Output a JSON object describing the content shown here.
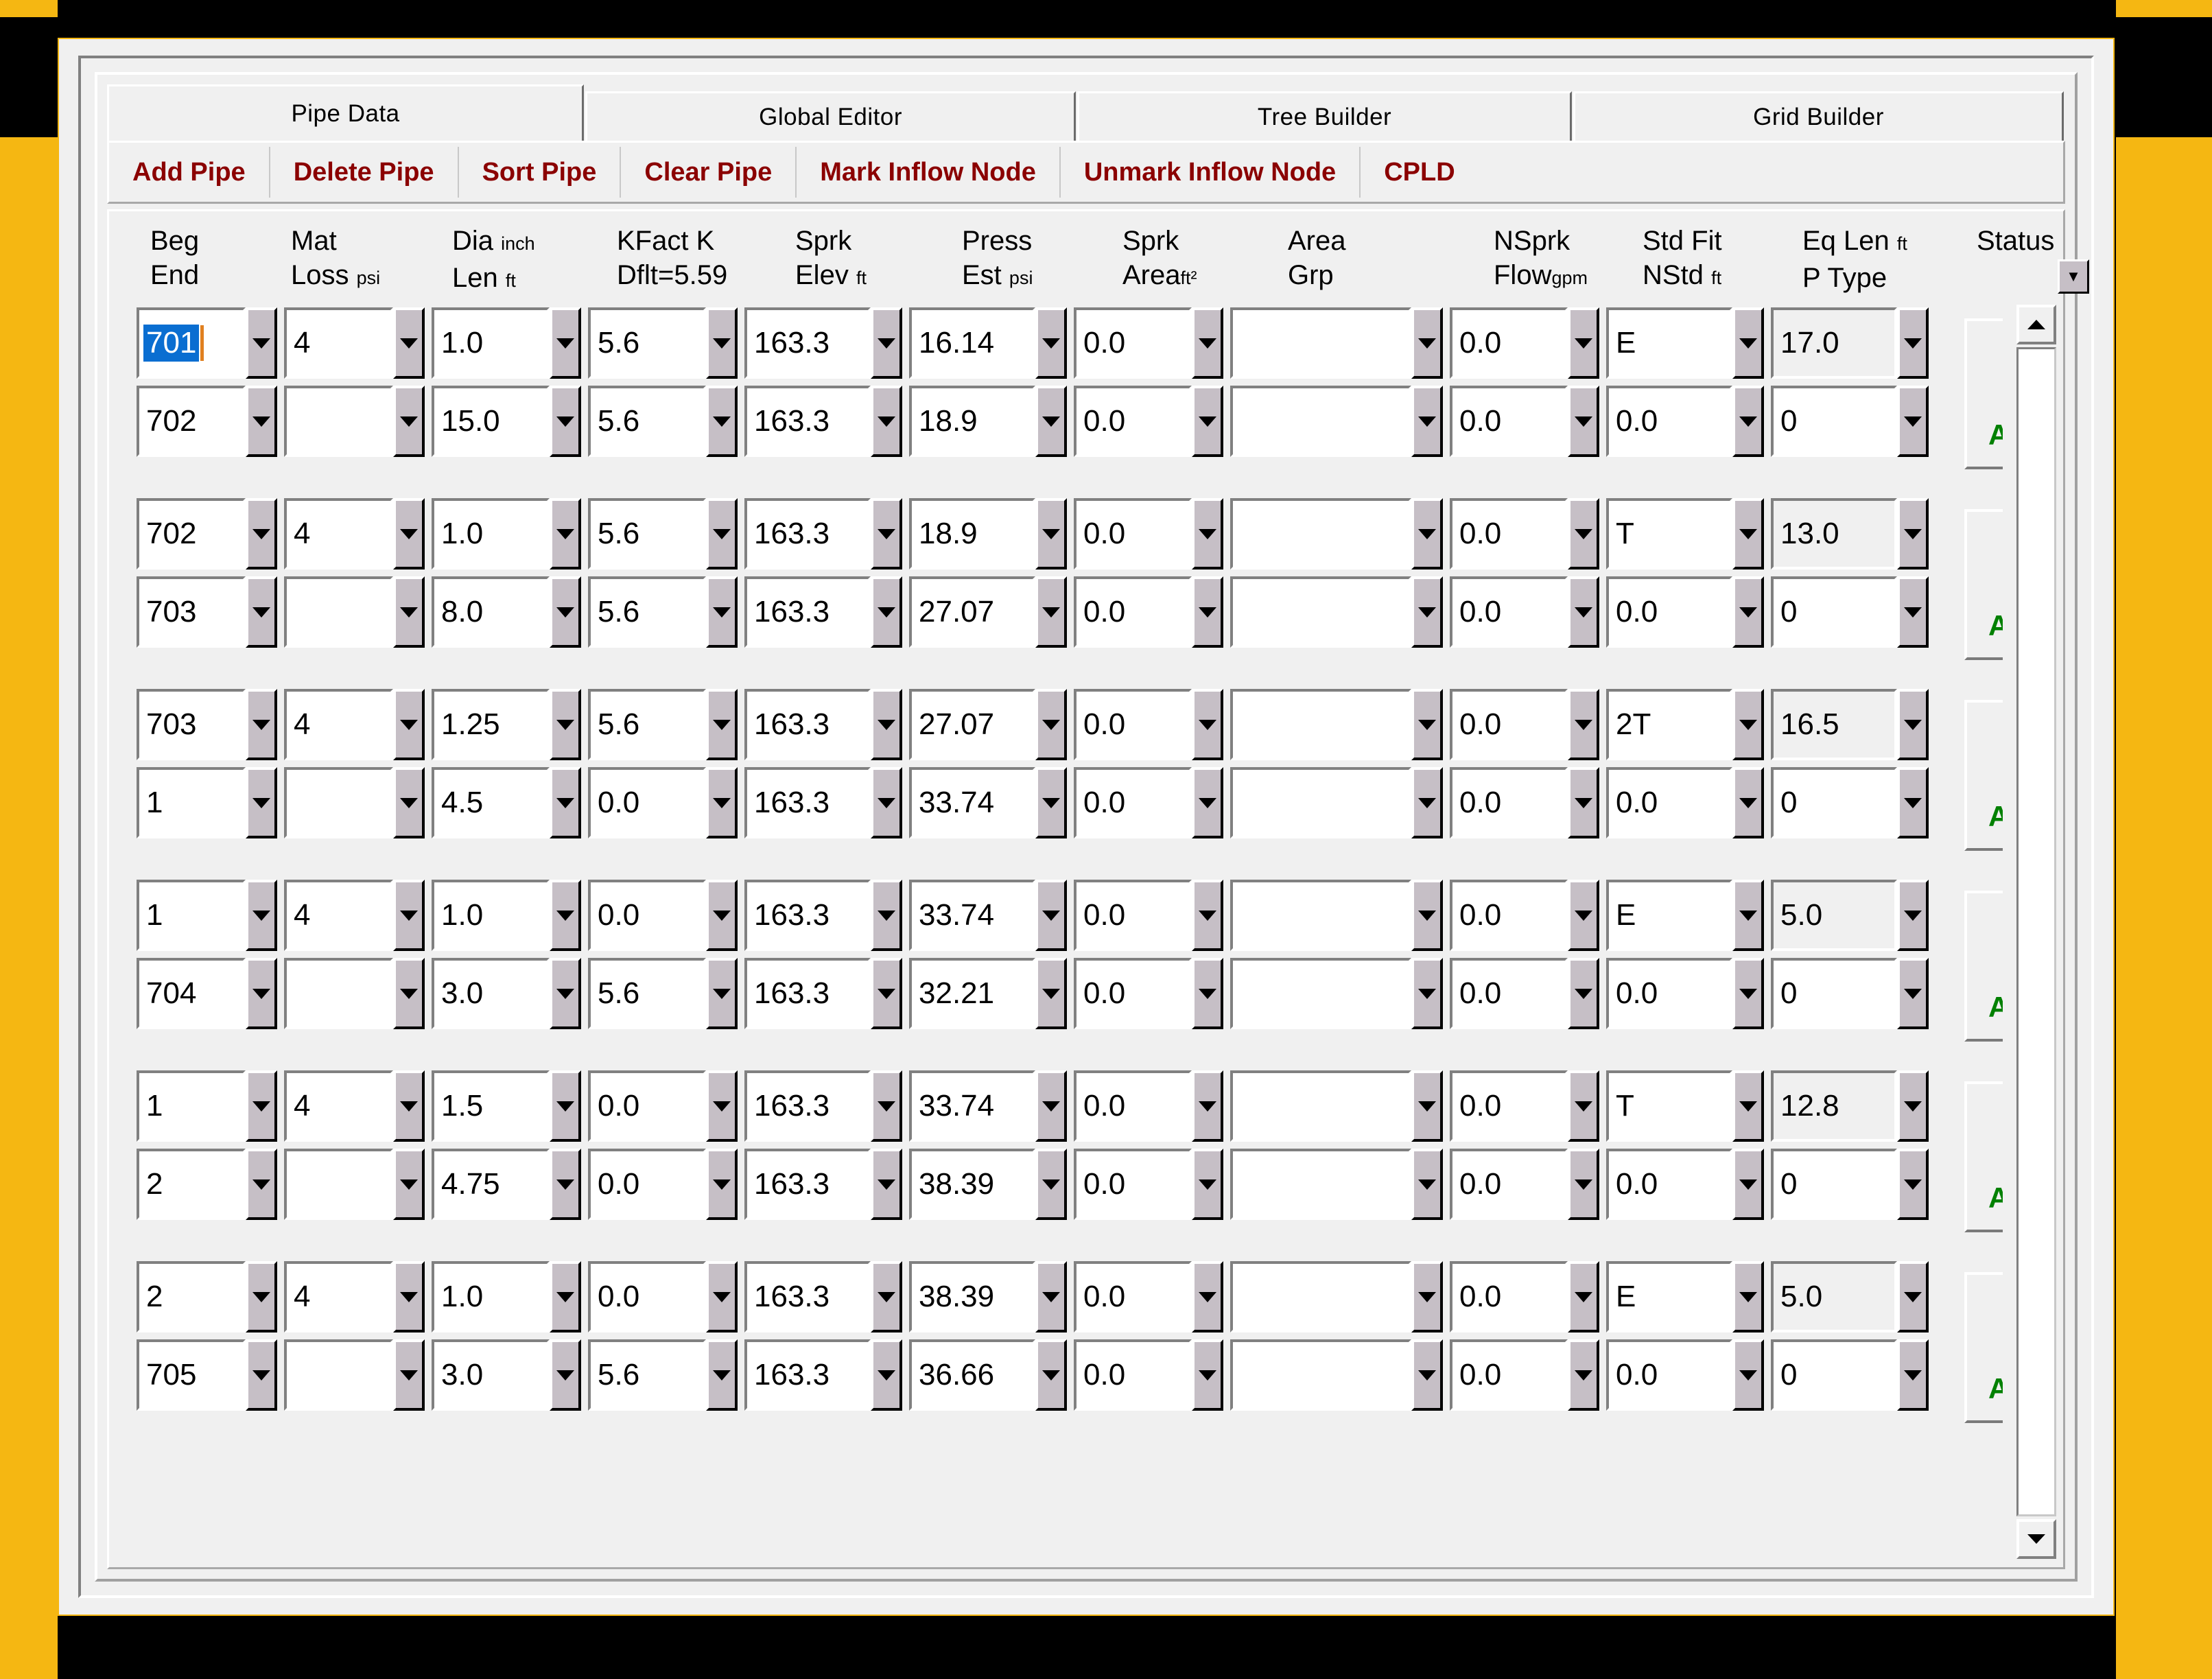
{
  "window": {
    "accent_frame_color": "#f5b712",
    "face_color": "#f0f0f0",
    "toolbar_text_color": "#8b0000",
    "status_text_color": "#008000",
    "selection_color": "#0a6ed1"
  },
  "tabs": [
    {
      "label": "Pipe Data",
      "active": true
    },
    {
      "label": "Global Editor",
      "active": false
    },
    {
      "label": "Tree Builder",
      "active": false
    },
    {
      "label": "Grid Builder",
      "active": false
    }
  ],
  "toolbar": {
    "buttons": [
      "Add Pipe",
      "Delete Pipe",
      "Sort Pipe",
      "Clear Pipe",
      "Mark Inflow Node",
      "Unmark Inflow Node",
      "CPLD"
    ]
  },
  "headers": [
    {
      "line1": "Beg",
      "line2": "End",
      "unit1": "",
      "unit2": ""
    },
    {
      "line1": "Mat",
      "line2": "Loss",
      "unit1": "",
      "unit2": "psi"
    },
    {
      "line1": "Dia",
      "line2": "Len",
      "unit1": "inch",
      "unit2": "ft"
    },
    {
      "line1": "KFact",
      "line2": "Dflt=5.59",
      "unit1": "K",
      "unit2": ""
    },
    {
      "line1": "Sprk",
      "line2": "Elev",
      "unit1": "",
      "unit2": "ft"
    },
    {
      "line1": "Press",
      "line2": "Est",
      "unit1": "",
      "unit2": "psi"
    },
    {
      "line1": "Sprk",
      "line2": "Area",
      "unit1": "",
      "unit2": "ft²"
    },
    {
      "line1": "Area",
      "line2": "Grp",
      "unit1": "",
      "unit2": ""
    },
    {
      "line1": "NSprk",
      "line2": "Flow",
      "unit1": "",
      "unit2": "gpm"
    },
    {
      "line1": "Std Fit",
      "line2": "NStd",
      "unit1": "",
      "unit2": "ft"
    },
    {
      "line1": "Eq Len",
      "line2": "P Type",
      "unit1": "ft",
      "unit2": ""
    },
    {
      "line1": "Status",
      "line2": "",
      "unit1": "",
      "unit2": ""
    }
  ],
  "pipes": [
    {
      "status": "Active",
      "beg": {
        "node": "701",
        "matloss": "4",
        "dia": "1.0",
        "kfact": "5.6",
        "elev": "163.3",
        "press": "16.14",
        "sprkarea": "0.0",
        "areagrp": "",
        "nsprk": "0.0",
        "stdfit": "E",
        "eqlen": "17.0",
        "selected": true
      },
      "end": {
        "node": "702",
        "matloss": "",
        "dia": "15.0",
        "kfact": "5.6",
        "elev": "163.3",
        "press": "18.9",
        "sprkarea": "0.0",
        "areagrp": "",
        "nsprk": "0.0",
        "stdfit": "0.0",
        "eqlen": "0",
        "selected": false
      }
    },
    {
      "status": "Active",
      "beg": {
        "node": "702",
        "matloss": "4",
        "dia": "1.0",
        "kfact": "5.6",
        "elev": "163.3",
        "press": "18.9",
        "sprkarea": "0.0",
        "areagrp": "",
        "nsprk": "0.0",
        "stdfit": "T",
        "eqlen": "13.0",
        "selected": false
      },
      "end": {
        "node": "703",
        "matloss": "",
        "dia": "8.0",
        "kfact": "5.6",
        "elev": "163.3",
        "press": "27.07",
        "sprkarea": "0.0",
        "areagrp": "",
        "nsprk": "0.0",
        "stdfit": "0.0",
        "eqlen": "0",
        "selected": false
      }
    },
    {
      "status": "Active",
      "beg": {
        "node": "703",
        "matloss": "4",
        "dia": "1.25",
        "kfact": "5.6",
        "elev": "163.3",
        "press": "27.07",
        "sprkarea": "0.0",
        "areagrp": "",
        "nsprk": "0.0",
        "stdfit": "2T",
        "eqlen": "16.5",
        "selected": false
      },
      "end": {
        "node": "1",
        "matloss": "",
        "dia": "4.5",
        "kfact": "0.0",
        "elev": "163.3",
        "press": "33.74",
        "sprkarea": "0.0",
        "areagrp": "",
        "nsprk": "0.0",
        "stdfit": "0.0",
        "eqlen": "0",
        "selected": false
      }
    },
    {
      "status": "Active",
      "beg": {
        "node": "1",
        "matloss": "4",
        "dia": "1.0",
        "kfact": "0.0",
        "elev": "163.3",
        "press": "33.74",
        "sprkarea": "0.0",
        "areagrp": "",
        "nsprk": "0.0",
        "stdfit": "E",
        "eqlen": "5.0",
        "selected": false
      },
      "end": {
        "node": "704",
        "matloss": "",
        "dia": "3.0",
        "kfact": "5.6",
        "elev": "163.3",
        "press": "32.21",
        "sprkarea": "0.0",
        "areagrp": "",
        "nsprk": "0.0",
        "stdfit": "0.0",
        "eqlen": "0",
        "selected": false
      }
    },
    {
      "status": "Active",
      "beg": {
        "node": "1",
        "matloss": "4",
        "dia": "1.5",
        "kfact": "0.0",
        "elev": "163.3",
        "press": "33.74",
        "sprkarea": "0.0",
        "areagrp": "",
        "nsprk": "0.0",
        "stdfit": "T",
        "eqlen": "12.8",
        "selected": false
      },
      "end": {
        "node": "2",
        "matloss": "",
        "dia": "4.75",
        "kfact": "0.0",
        "elev": "163.3",
        "press": "38.39",
        "sprkarea": "0.0",
        "areagrp": "",
        "nsprk": "0.0",
        "stdfit": "0.0",
        "eqlen": "0",
        "selected": false
      }
    },
    {
      "status": "Active",
      "beg": {
        "node": "2",
        "matloss": "4",
        "dia": "1.0",
        "kfact": "0.0",
        "elev": "163.3",
        "press": "38.39",
        "sprkarea": "0.0",
        "areagrp": "",
        "nsprk": "0.0",
        "stdfit": "E",
        "eqlen": "5.0",
        "selected": false
      },
      "end": {
        "node": "705",
        "matloss": "",
        "dia": "3.0",
        "kfact": "5.6",
        "elev": "163.3",
        "press": "36.66",
        "sprkarea": "0.0",
        "areagrp": "",
        "nsprk": "0.0",
        "stdfit": "0.0",
        "eqlen": "0",
        "selected": false
      }
    }
  ],
  "icons": {
    "dropdown": "chevron-down-icon",
    "scroll_up": "scroll-up-arrow-icon",
    "scroll_down": "scroll-down-arrow-icon"
  }
}
